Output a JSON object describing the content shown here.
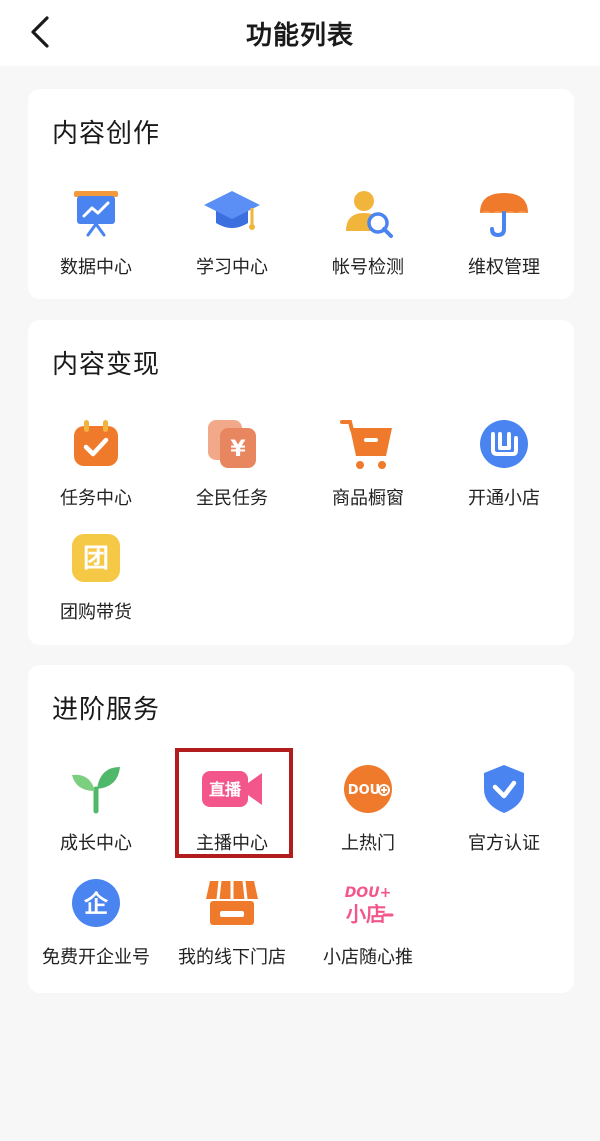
{
  "header": {
    "title": "功能列表"
  },
  "sections": [
    {
      "title": "内容创作",
      "items": [
        {
          "label": "数据中心",
          "icon": "presentation-chart-icon"
        },
        {
          "label": "学习中心",
          "icon": "graduation-cap-icon"
        },
        {
          "label": "帐号检测",
          "icon": "user-search-icon"
        },
        {
          "label": "维权管理",
          "icon": "umbrella-icon"
        }
      ]
    },
    {
      "title": "内容变现",
      "items": [
        {
          "label": "任务中心",
          "icon": "calendar-check-icon"
        },
        {
          "label": "全民任务",
          "icon": "yen-card-icon",
          "glyph": "¥"
        },
        {
          "label": "商品橱窗",
          "icon": "shopping-cart-icon"
        },
        {
          "label": "开通小店",
          "icon": "shop-logo-icon"
        },
        {
          "label": "团购带货",
          "icon": "group-buy-icon",
          "glyph": "团"
        }
      ]
    },
    {
      "title": "进阶服务",
      "items": [
        {
          "label": "成长中心",
          "icon": "sprout-icon"
        },
        {
          "label": "主播中心",
          "icon": "live-camera-icon",
          "glyph": "直播"
        },
        {
          "label": "上热门",
          "icon": "dou-plus-icon",
          "glyph": "DOU"
        },
        {
          "label": "官方认证",
          "icon": "shield-check-icon"
        },
        {
          "label": "免费开企业号",
          "icon": "enterprise-icon",
          "glyph": "企"
        },
        {
          "label": "我的线下门店",
          "icon": "storefront-icon"
        },
        {
          "label": "小店随心推",
          "icon": "dou-shop-icon",
          "glyph_top": "DOU+",
          "glyph_bottom": "小店"
        }
      ]
    }
  ],
  "colors": {
    "background": "#f7f7f7",
    "card": "#ffffff",
    "highlight_border": "#b21c1c"
  }
}
